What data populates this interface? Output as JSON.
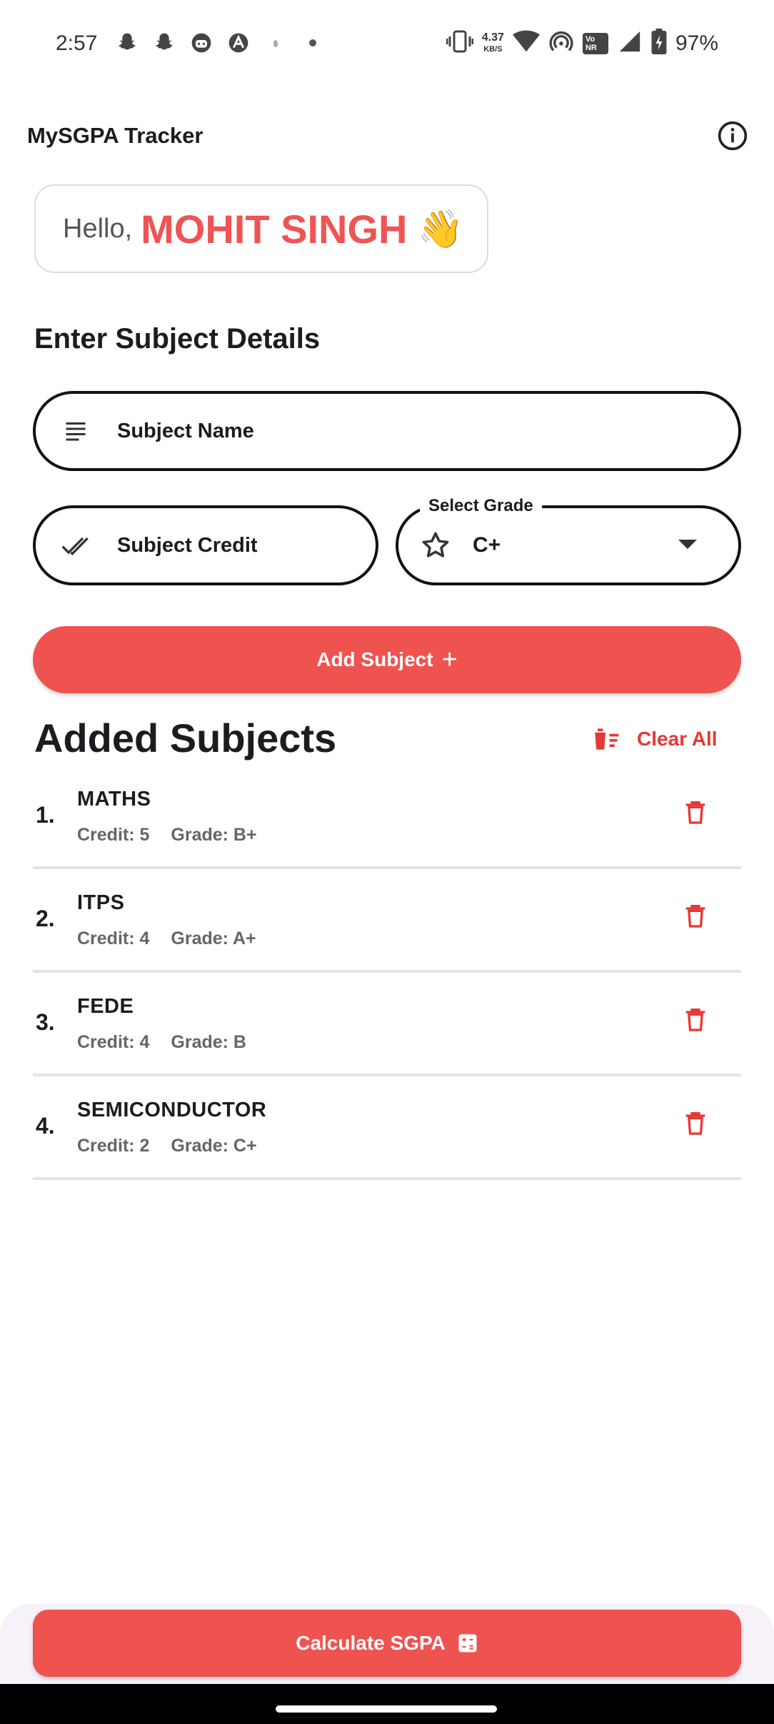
{
  "status_bar": {
    "time": "2:57",
    "net_speed_value": "4.37",
    "net_speed_unit": "KB/S",
    "volte_label": "Vo NR",
    "battery": "97%"
  },
  "app_bar": {
    "title": "MySGPA Tracker",
    "info_icon": "info-icon"
  },
  "greeting": {
    "hello": "Hello,",
    "name": "MOHIT SINGH",
    "emoji": "👋"
  },
  "form": {
    "section_title": "Enter Subject Details",
    "subject_name_placeholder": "Subject Name",
    "subject_credit_placeholder": "Subject Credit",
    "grade_label": "Select Grade",
    "grade_value": "C+",
    "add_button": "Add Subject",
    "add_button_icon": "+"
  },
  "subjects": {
    "title": "Added Subjects",
    "clear_all": "Clear All",
    "items": [
      {
        "num": "1.",
        "name": "MATHS",
        "credit": "Credit: 5",
        "grade": "Grade: B+"
      },
      {
        "num": "2.",
        "name": "ITPS",
        "credit": "Credit: 4",
        "grade": "Grade: A+"
      },
      {
        "num": "3.",
        "name": "FEDE",
        "credit": "Credit: 4",
        "grade": "Grade: B"
      },
      {
        "num": "4.",
        "name": "SEMICONDUCTOR",
        "credit": "Credit: 2",
        "grade": "Grade: C+"
      }
    ]
  },
  "footer": {
    "calculate_button": "Calculate SGPA"
  },
  "colors": {
    "accent": "#ef5350",
    "name_red": "#ee5454",
    "delete_red": "#e53935"
  }
}
